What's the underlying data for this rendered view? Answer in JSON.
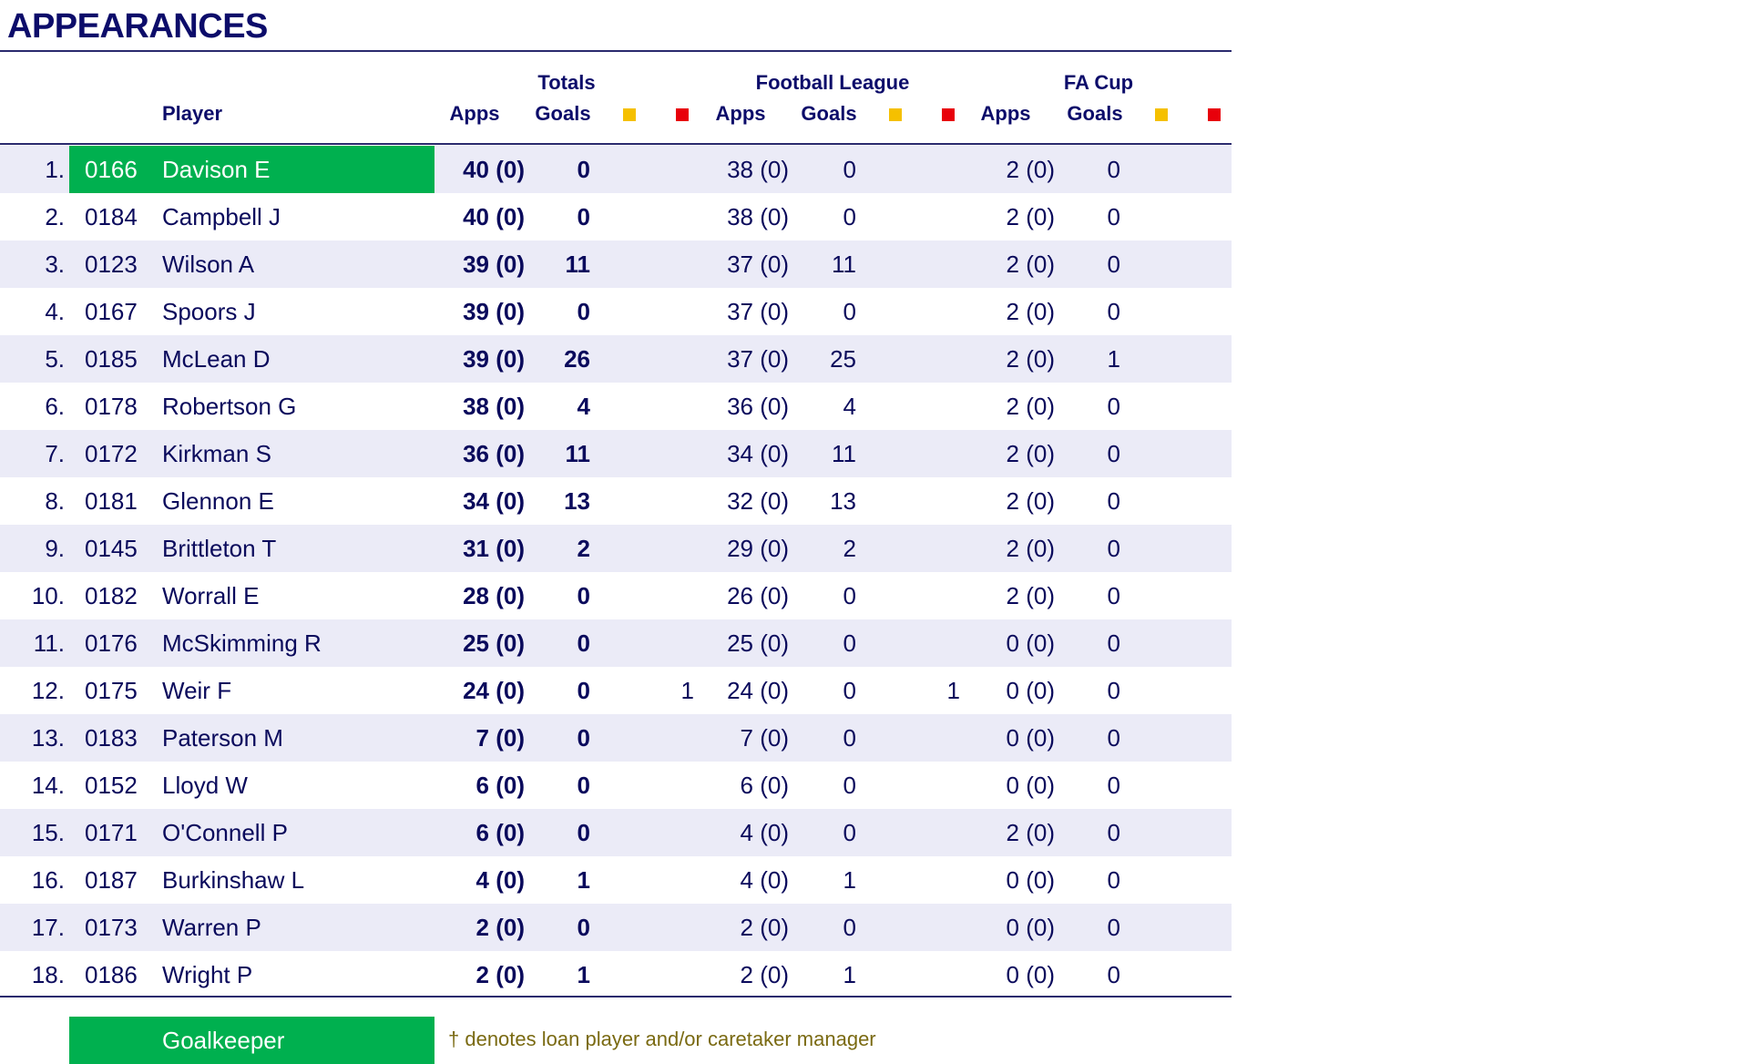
{
  "title": "APPEARANCES",
  "headers": {
    "player": "Player",
    "groups": {
      "totals": "Totals",
      "league": "Football League",
      "cup": "FA Cup"
    },
    "apps": "Apps",
    "goals": "Goals"
  },
  "colors": {
    "yellow_card": "#f5c000",
    "red_card": "#e8000b",
    "goalkeeper": "#00b04f",
    "alt_row": "#ebebf7"
  },
  "rows": [
    {
      "pos": "1.",
      "id": "0166",
      "name": "Davison E",
      "tot_apps": "40 (0)",
      "tot_goals": "0",
      "tot_yel": "",
      "tot_red": "",
      "lg_apps": "38 (0)",
      "lg_goals": "0",
      "lg_yel": "",
      "lg_red": "",
      "cup_apps": "2 (0)",
      "cup_goals": "0",
      "cup_yel": "",
      "cup_red": "",
      "gk": true
    },
    {
      "pos": "2.",
      "id": "0184",
      "name": "Campbell J",
      "tot_apps": "40 (0)",
      "tot_goals": "0",
      "tot_yel": "",
      "tot_red": "",
      "lg_apps": "38 (0)",
      "lg_goals": "0",
      "lg_yel": "",
      "lg_red": "",
      "cup_apps": "2 (0)",
      "cup_goals": "0",
      "cup_yel": "",
      "cup_red": "",
      "gk": false
    },
    {
      "pos": "3.",
      "id": "0123",
      "name": "Wilson A",
      "tot_apps": "39 (0)",
      "tot_goals": "11",
      "tot_yel": "",
      "tot_red": "",
      "lg_apps": "37 (0)",
      "lg_goals": "11",
      "lg_yel": "",
      "lg_red": "",
      "cup_apps": "2 (0)",
      "cup_goals": "0",
      "cup_yel": "",
      "cup_red": "",
      "gk": false
    },
    {
      "pos": "4.",
      "id": "0167",
      "name": "Spoors J",
      "tot_apps": "39 (0)",
      "tot_goals": "0",
      "tot_yel": "",
      "tot_red": "",
      "lg_apps": "37 (0)",
      "lg_goals": "0",
      "lg_yel": "",
      "lg_red": "",
      "cup_apps": "2 (0)",
      "cup_goals": "0",
      "cup_yel": "",
      "cup_red": "",
      "gk": false
    },
    {
      "pos": "5.",
      "id": "0185",
      "name": "McLean D",
      "tot_apps": "39 (0)",
      "tot_goals": "26",
      "tot_yel": "",
      "tot_red": "",
      "lg_apps": "37 (0)",
      "lg_goals": "25",
      "lg_yel": "",
      "lg_red": "",
      "cup_apps": "2 (0)",
      "cup_goals": "1",
      "cup_yel": "",
      "cup_red": "",
      "gk": false
    },
    {
      "pos": "6.",
      "id": "0178",
      "name": "Robertson G",
      "tot_apps": "38 (0)",
      "tot_goals": "4",
      "tot_yel": "",
      "tot_red": "",
      "lg_apps": "36 (0)",
      "lg_goals": "4",
      "lg_yel": "",
      "lg_red": "",
      "cup_apps": "2 (0)",
      "cup_goals": "0",
      "cup_yel": "",
      "cup_red": "",
      "gk": false
    },
    {
      "pos": "7.",
      "id": "0172",
      "name": "Kirkman S",
      "tot_apps": "36 (0)",
      "tot_goals": "11",
      "tot_yel": "",
      "tot_red": "",
      "lg_apps": "34 (0)",
      "lg_goals": "11",
      "lg_yel": "",
      "lg_red": "",
      "cup_apps": "2 (0)",
      "cup_goals": "0",
      "cup_yel": "",
      "cup_red": "",
      "gk": false
    },
    {
      "pos": "8.",
      "id": "0181",
      "name": "Glennon E",
      "tot_apps": "34 (0)",
      "tot_goals": "13",
      "tot_yel": "",
      "tot_red": "",
      "lg_apps": "32 (0)",
      "lg_goals": "13",
      "lg_yel": "",
      "lg_red": "",
      "cup_apps": "2 (0)",
      "cup_goals": "0",
      "cup_yel": "",
      "cup_red": "",
      "gk": false
    },
    {
      "pos": "9.",
      "id": "0145",
      "name": "Brittleton T",
      "tot_apps": "31 (0)",
      "tot_goals": "2",
      "tot_yel": "",
      "tot_red": "",
      "lg_apps": "29 (0)",
      "lg_goals": "2",
      "lg_yel": "",
      "lg_red": "",
      "cup_apps": "2 (0)",
      "cup_goals": "0",
      "cup_yel": "",
      "cup_red": "",
      "gk": false
    },
    {
      "pos": "10.",
      "id": "0182",
      "name": "Worrall E",
      "tot_apps": "28 (0)",
      "tot_goals": "0",
      "tot_yel": "",
      "tot_red": "",
      "lg_apps": "26 (0)",
      "lg_goals": "0",
      "lg_yel": "",
      "lg_red": "",
      "cup_apps": "2 (0)",
      "cup_goals": "0",
      "cup_yel": "",
      "cup_red": "",
      "gk": false
    },
    {
      "pos": "11.",
      "id": "0176",
      "name": "McSkimming R",
      "tot_apps": "25 (0)",
      "tot_goals": "0",
      "tot_yel": "",
      "tot_red": "",
      "lg_apps": "25 (0)",
      "lg_goals": "0",
      "lg_yel": "",
      "lg_red": "",
      "cup_apps": "0 (0)",
      "cup_goals": "0",
      "cup_yel": "",
      "cup_red": "",
      "gk": false
    },
    {
      "pos": "12.",
      "id": "0175",
      "name": "Weir F",
      "tot_apps": "24 (0)",
      "tot_goals": "0",
      "tot_yel": "",
      "tot_red": "1",
      "lg_apps": "24 (0)",
      "lg_goals": "0",
      "lg_yel": "",
      "lg_red": "1",
      "cup_apps": "0 (0)",
      "cup_goals": "0",
      "cup_yel": "",
      "cup_red": "",
      "gk": false
    },
    {
      "pos": "13.",
      "id": "0183",
      "name": "Paterson M",
      "tot_apps": "7 (0)",
      "tot_goals": "0",
      "tot_yel": "",
      "tot_red": "",
      "lg_apps": "7 (0)",
      "lg_goals": "0",
      "lg_yel": "",
      "lg_red": "",
      "cup_apps": "0 (0)",
      "cup_goals": "0",
      "cup_yel": "",
      "cup_red": "",
      "gk": false
    },
    {
      "pos": "14.",
      "id": "0152",
      "name": "Lloyd W",
      "tot_apps": "6 (0)",
      "tot_goals": "0",
      "tot_yel": "",
      "tot_red": "",
      "lg_apps": "6 (0)",
      "lg_goals": "0",
      "lg_yel": "",
      "lg_red": "",
      "cup_apps": "0 (0)",
      "cup_goals": "0",
      "cup_yel": "",
      "cup_red": "",
      "gk": false
    },
    {
      "pos": "15.",
      "id": "0171",
      "name": "O'Connell P",
      "tot_apps": "6 (0)",
      "tot_goals": "0",
      "tot_yel": "",
      "tot_red": "",
      "lg_apps": "4 (0)",
      "lg_goals": "0",
      "lg_yel": "",
      "lg_red": "",
      "cup_apps": "2 (0)",
      "cup_goals": "0",
      "cup_yel": "",
      "cup_red": "",
      "gk": false
    },
    {
      "pos": "16.",
      "id": "0187",
      "name": "Burkinshaw L",
      "tot_apps": "4 (0)",
      "tot_goals": "1",
      "tot_yel": "",
      "tot_red": "",
      "lg_apps": "4 (0)",
      "lg_goals": "1",
      "lg_yel": "",
      "lg_red": "",
      "cup_apps": "0 (0)",
      "cup_goals": "0",
      "cup_yel": "",
      "cup_red": "",
      "gk": false
    },
    {
      "pos": "17.",
      "id": "0173",
      "name": "Warren P",
      "tot_apps": "2 (0)",
      "tot_goals": "0",
      "tot_yel": "",
      "tot_red": "",
      "lg_apps": "2 (0)",
      "lg_goals": "0",
      "lg_yel": "",
      "lg_red": "",
      "cup_apps": "0 (0)",
      "cup_goals": "0",
      "cup_yel": "",
      "cup_red": "",
      "gk": false
    },
    {
      "pos": "18.",
      "id": "0186",
      "name": "Wright P",
      "tot_apps": "2 (0)",
      "tot_goals": "1",
      "tot_yel": "",
      "tot_red": "",
      "lg_apps": "2 (0)",
      "lg_goals": "1",
      "lg_yel": "",
      "lg_red": "",
      "cup_apps": "0 (0)",
      "cup_goals": "0",
      "cup_yel": "",
      "cup_red": "",
      "gk": false
    }
  ],
  "legend": {
    "goalkeeper": "Goalkeeper",
    "loan_note": "† denotes loan player and/or caretaker manager"
  }
}
